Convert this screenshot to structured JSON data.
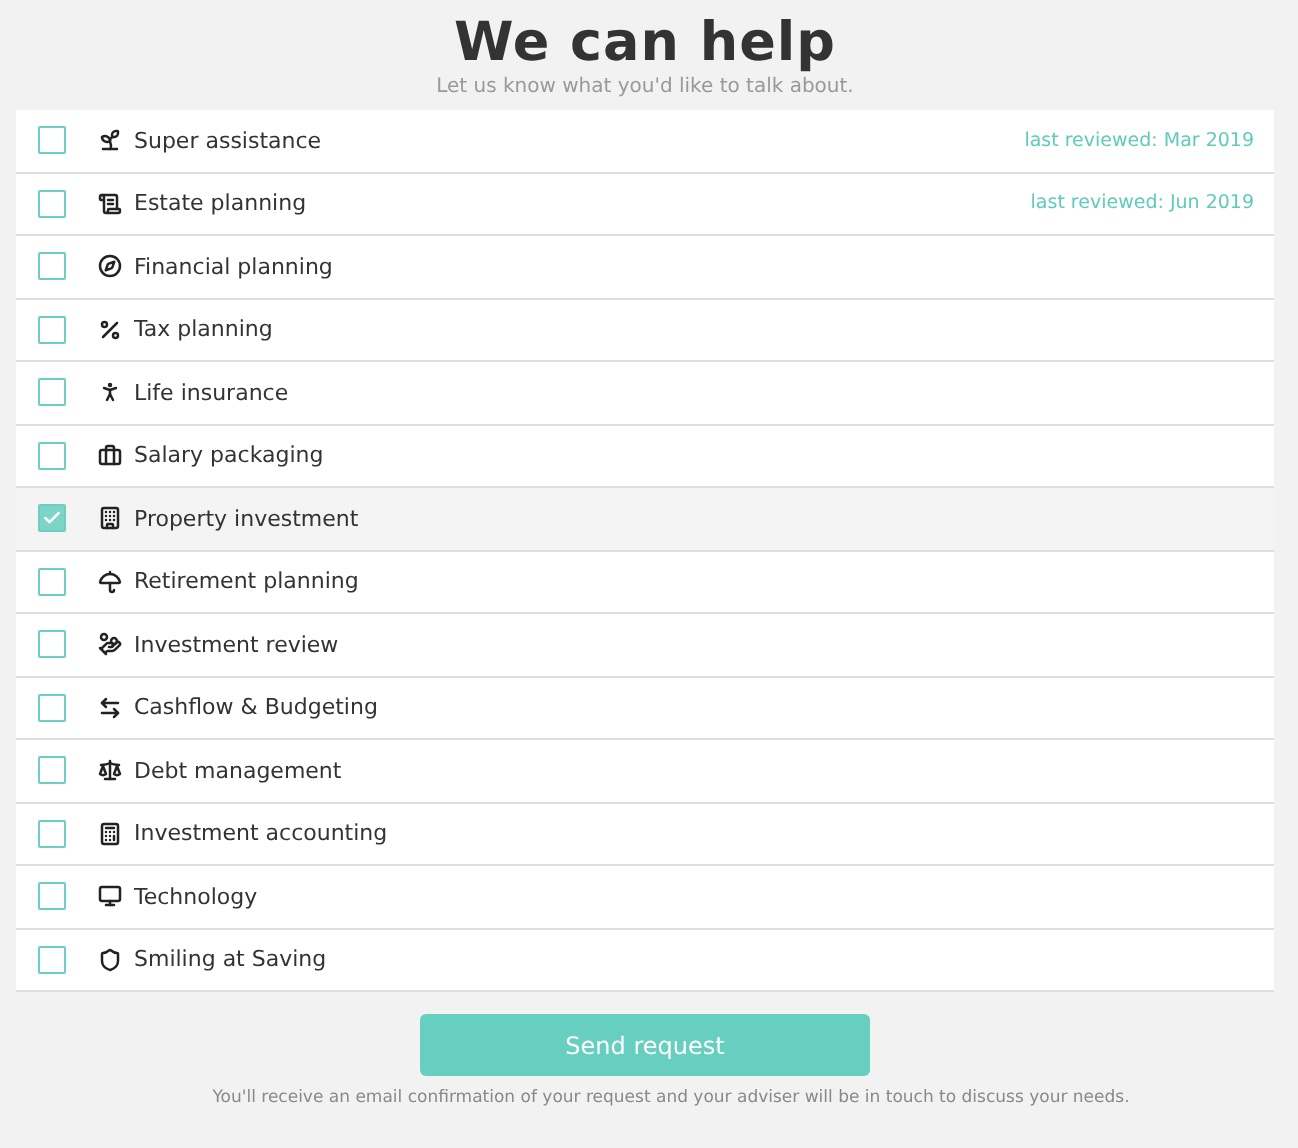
{
  "header": {
    "title": "We can help",
    "subtitle": "Let us know what you'd like to talk about."
  },
  "topics": [
    {
      "label": "Super assistance",
      "selected": false,
      "reviewed": "last reviewed: Mar 2019"
    },
    {
      "label": "Estate planning",
      "selected": false,
      "reviewed": "last reviewed: Jun 2019"
    },
    {
      "label": "Financial planning",
      "selected": false
    },
    {
      "label": "Tax planning",
      "selected": false
    },
    {
      "label": "Life insurance",
      "selected": false
    },
    {
      "label": "Salary packaging",
      "selected": false
    },
    {
      "label": "Property investment",
      "selected": true
    },
    {
      "label": "Retirement planning",
      "selected": false
    },
    {
      "label": "Investment review",
      "selected": false
    },
    {
      "label": "Cashflow & Budgeting",
      "selected": false
    },
    {
      "label": "Debt management",
      "selected": false
    },
    {
      "label": "Investment accounting",
      "selected": false
    },
    {
      "label": "Technology",
      "selected": false
    },
    {
      "label": "Smiling at Saving",
      "selected": false
    }
  ],
  "submit": {
    "label": "Send request",
    "note": "You'll receive an email confirmation of your request and your adviser will be in touch to discuss your needs."
  }
}
